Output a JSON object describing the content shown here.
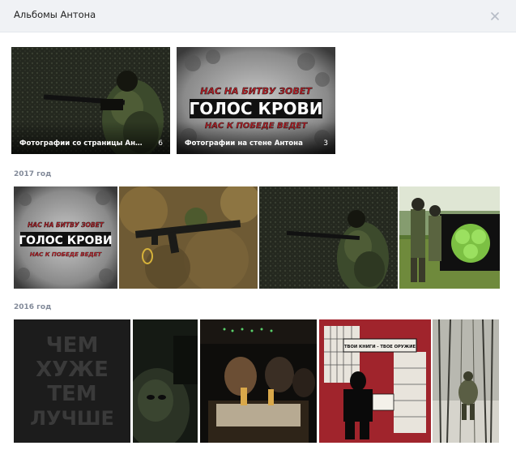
{
  "header": {
    "title": "Альбомы Антона",
    "close_icon": "close-icon"
  },
  "albums": [
    {
      "title": "Фотографии со страницы Антона",
      "count": "6"
    },
    {
      "title": "Фотографии на стене Антона",
      "count": "3"
    }
  ],
  "poster": {
    "line1": "НАС НА БИТВУ ЗОВЕТ",
    "line2": "ГОЛОС КРОВИ",
    "line3": "НАС К ПОБЕДЕ ВЕДЕТ"
  },
  "sections": [
    {
      "year": "2017 год"
    },
    {
      "year": "2016 год"
    }
  ],
  "slogan": {
    "line1": "ЧЕМ",
    "line2": "ХУЖЕ",
    "line3": "ТЕМ",
    "line4": "ЛУЧШЕ"
  },
  "books_poster": {
    "caption": "ТВОИ КНИГИ - ТВОЕ ОРУЖИЕ"
  },
  "colors": {
    "header_bg": "#f0f2f5",
    "year_label": "#828a99",
    "poster_red": "#c21f27",
    "books_bg": "#a0242c"
  }
}
